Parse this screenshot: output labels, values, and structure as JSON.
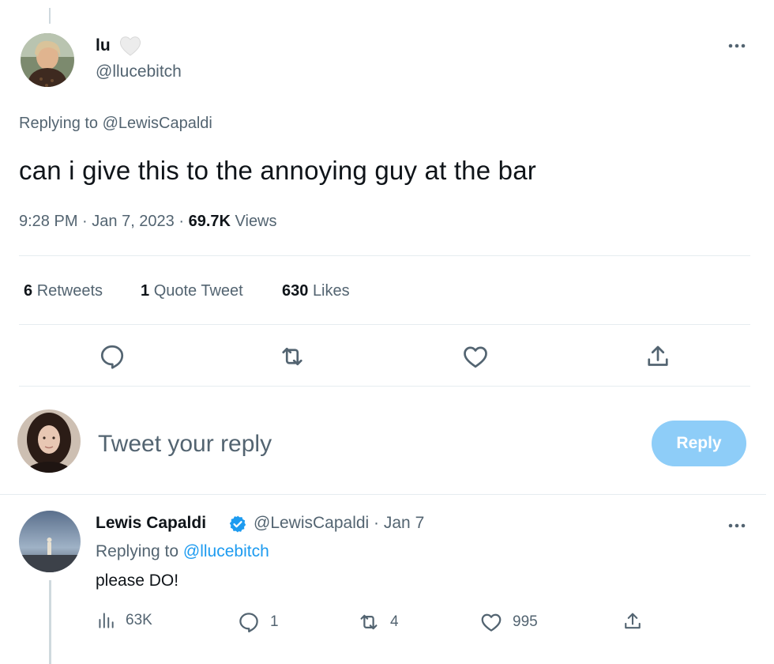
{
  "main_tweet": {
    "display_name": "lu",
    "handle": "@llucebitch",
    "replying_to": "Replying to @LewisCapaldi",
    "text": "can i give this to the annoying guy at the bar",
    "time": "9:28 PM",
    "date": "Jan 7, 2023",
    "views_count": "69.7K",
    "views_label": "Views",
    "stats": {
      "retweets_count": "6",
      "retweets_label": "Retweets",
      "quotes_count": "1",
      "quotes_label": "Quote Tweet",
      "likes_count": "630",
      "likes_label": "Likes"
    }
  },
  "compose": {
    "placeholder": "Tweet your reply",
    "button_label": "Reply"
  },
  "reply_tweet": {
    "display_name": "Lewis Capaldi",
    "handle_date": "@LewisCapaldi · Jan 7",
    "replying_prefix": "Replying to",
    "replying_handle": "@llucebitch",
    "text": "please DO!",
    "views": "63K",
    "replies": "1",
    "retweets": "4",
    "likes": "995"
  },
  "icons": [
    "more-icon",
    "reply-icon",
    "retweet-icon",
    "like-icon",
    "share-icon",
    "verified-icon",
    "views-icon",
    "white-heart-emoji"
  ],
  "colors": {
    "accent": "#1d9bf0",
    "reply_button": "#8ecdf8",
    "secondary_text": "#536471",
    "primary_text": "#0f1419"
  }
}
